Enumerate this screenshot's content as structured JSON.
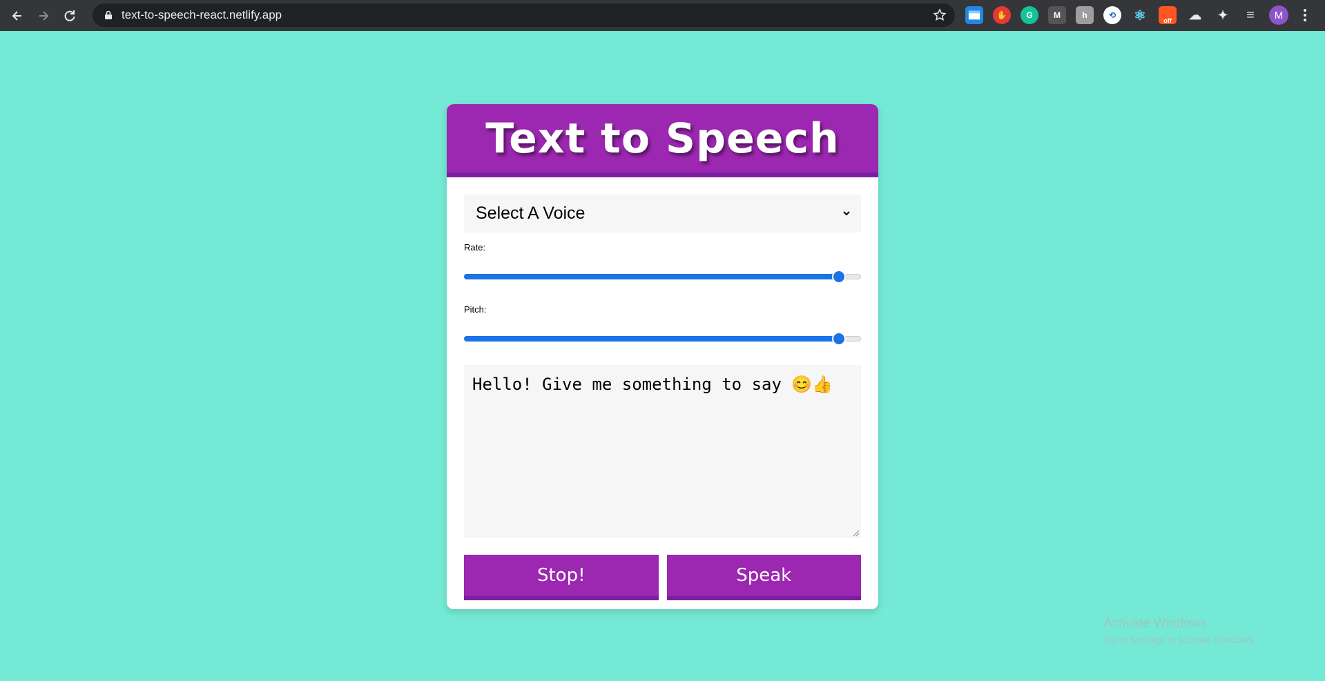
{
  "browser": {
    "url": "text-to-speech-react.netlify.app",
    "profile_initial": "M",
    "extensions": [
      {
        "icon": "window-ext-icon",
        "color": "#1e88e5",
        "glyph": ""
      },
      {
        "icon": "hand-stop-ext-icon",
        "color": "#e53935",
        "glyph": ""
      },
      {
        "icon": "grammarly-icon",
        "color": "#15c39a",
        "glyph": "G"
      },
      {
        "icon": "m-ext-icon",
        "color": "#555555",
        "glyph": "M"
      },
      {
        "icon": "h-ext-icon",
        "color": "#9e9e9e",
        "glyph": "h"
      },
      {
        "icon": "circle-ext-icon",
        "color": "#ffffff",
        "glyph": ""
      },
      {
        "icon": "react-devtools-icon",
        "color": "#35363a",
        "glyph": "⚛"
      },
      {
        "icon": "off-ext-icon",
        "color": "#ff5722",
        "glyph": "off"
      },
      {
        "icon": "cloud-ext-icon",
        "color": "#35363a",
        "glyph": "☁"
      },
      {
        "icon": "puzzle-icon",
        "color": "#35363a",
        "glyph": "✦"
      },
      {
        "icon": "playlist-icon",
        "color": "#35363a",
        "glyph": "≡"
      }
    ]
  },
  "app": {
    "title": "Text to Speech",
    "voice_select": "Select A Voice",
    "rate_label": "Rate:",
    "pitch_label": "Pitch:",
    "rate_value": 0.96,
    "pitch_value": 0.96,
    "textarea_value": "Hello! Give me something to say 😊👍",
    "stop_label": "Stop!",
    "speak_label": "Speak"
  },
  "watermark": {
    "title": "Activate Windows",
    "subtitle": "Go to Settings to activate Windows."
  }
}
